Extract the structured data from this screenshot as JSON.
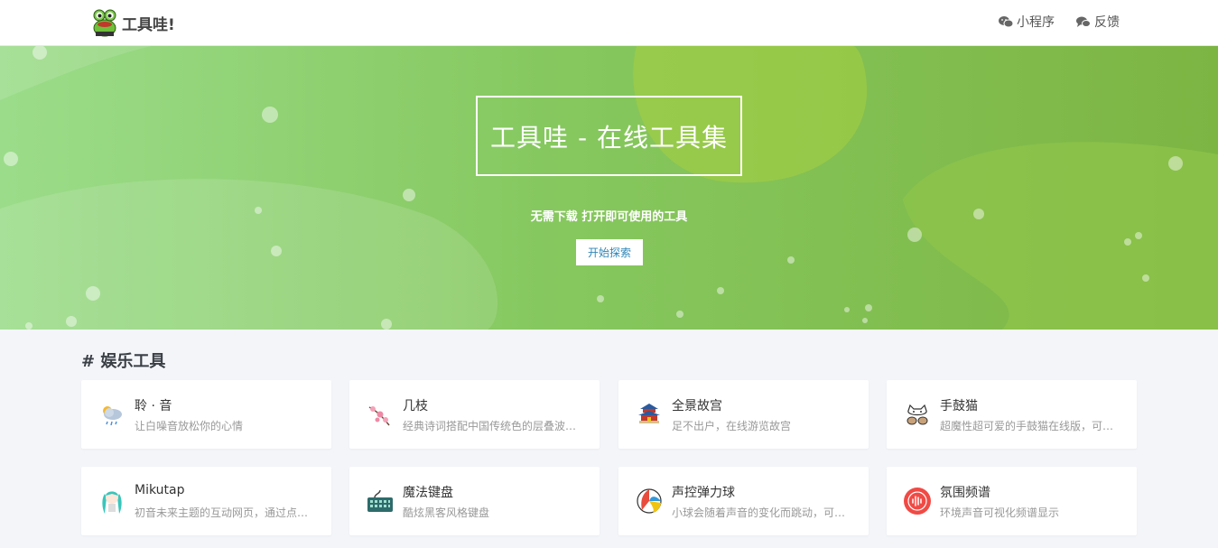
{
  "header": {
    "brand_name": "工具哇!",
    "nav": [
      {
        "label": "小程序",
        "icon": "wechat-icon"
      },
      {
        "label": "反馈",
        "icon": "comments-icon"
      }
    ]
  },
  "hero": {
    "title": "工具哇 - 在线工具集",
    "subtitle": "无需下载 打开即可使用的工具",
    "cta_label": "开始探索"
  },
  "section": {
    "title": "# 娱乐工具"
  },
  "cards": [
    {
      "title": "聆 · 音",
      "desc": "让白噪音放松你的心情",
      "icon": "rain-cloud-icon"
    },
    {
      "title": "几枝",
      "desc": "经典诗词搭配中国传统色的层叠波浪效果",
      "icon": "plum-blossom-icon"
    },
    {
      "title": "全景故宫",
      "desc": "足不出户，在线游览故宫",
      "icon": "palace-icon"
    },
    {
      "title": "手鼓猫",
      "desc": "超魔性超可爱的手鼓猫在线版，可以自由敲打",
      "icon": "bongo-cat-icon"
    },
    {
      "title": "Mikutap",
      "desc": "初音未来主题的互动网页，通过点击键盘演奏",
      "icon": "miku-icon"
    },
    {
      "title": "魔法键盘",
      "desc": "酷炫黑客风格键盘",
      "icon": "keyboard-icon"
    },
    {
      "title": "声控弹力球",
      "desc": "小球会随着声音的变化而跳动，可以用来发泄",
      "icon": "beach-ball-icon"
    },
    {
      "title": "氛围频谱",
      "desc": "环境声音可视化频谱显示",
      "icon": "spectrum-icon"
    }
  ],
  "colors": {
    "hero_start": "#9bdc8a",
    "hero_end": "#7db543",
    "cta_text": "#2f86b8",
    "page_bg": "#f3f5f9"
  }
}
